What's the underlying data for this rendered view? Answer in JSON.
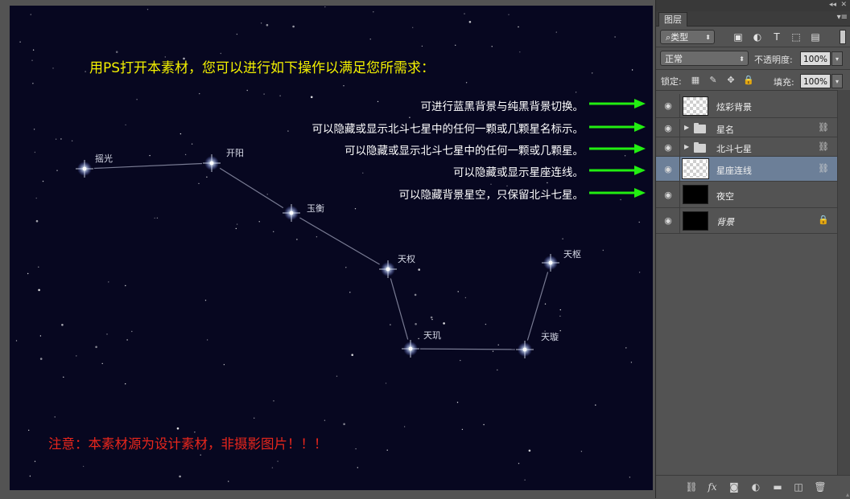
{
  "canvas": {
    "headline": "用PS打开本素材，您可以进行如下操作以满足您所需求：",
    "notes": [
      "可进行蓝黑背景与纯黑背景切换。",
      "可以隐藏或显示北斗七星中的任何一颗或几颗星名标示。",
      "可以隐藏或显示北斗七星中的任何一颗或几颗星。",
      "可以隐藏或显示星座连线。",
      "可以隐藏背景星空，只保留北斗七星。"
    ],
    "warning": "注意：本素材源为设计素材，非摄影图片！！！",
    "star_names": [
      "摇光",
      "开阳",
      "玉衡",
      "天权",
      "天玑",
      "天璇",
      "天枢"
    ],
    "colors": {
      "background": "#070720",
      "headline": "#f3f000",
      "warning": "#e8261c",
      "arrow": "#22ee11",
      "constellation_line": "#8d90a8"
    }
  },
  "panel": {
    "tab": "图层",
    "filter": {
      "kind": "类型",
      "icons": [
        "image-filter-icon",
        "adjustment-filter-icon",
        "type-filter-icon",
        "shape-filter-icon",
        "smart-object-filter-icon"
      ]
    },
    "blend_mode": "正常",
    "opacity": {
      "label": "不透明度:",
      "value": "100%"
    },
    "lock": {
      "label": "锁定:",
      "icons": [
        "lock-transparent-icon",
        "lock-brush-icon",
        "lock-move-icon",
        "lock-all-icon"
      ]
    },
    "fill": {
      "label": "填充:",
      "value": "100%"
    },
    "layers": [
      {
        "name": "炫彩背景",
        "thumb": "checker",
        "group": false,
        "linked": false,
        "locked": false,
        "selected": false,
        "italic": false
      },
      {
        "name": "星名",
        "thumb": "folder",
        "group": true,
        "linked": true,
        "locked": false,
        "selected": false,
        "italic": false
      },
      {
        "name": "北斗七星",
        "thumb": "folder",
        "group": true,
        "linked": true,
        "locked": false,
        "selected": false,
        "italic": false
      },
      {
        "name": "星座连线",
        "thumb": "checker",
        "group": false,
        "linked": true,
        "locked": false,
        "selected": true,
        "italic": false
      },
      {
        "name": "夜空",
        "thumb": "black",
        "group": false,
        "linked": false,
        "locked": false,
        "selected": false,
        "italic": false
      },
      {
        "name": "背景",
        "thumb": "black",
        "group": false,
        "linked": false,
        "locked": true,
        "selected": false,
        "italic": true
      }
    ],
    "bottom_icons": [
      "link-layers-icon",
      "fx-icon",
      "mask-icon",
      "adjustment-layer-icon",
      "new-group-icon",
      "new-layer-icon",
      "trash-icon"
    ]
  }
}
